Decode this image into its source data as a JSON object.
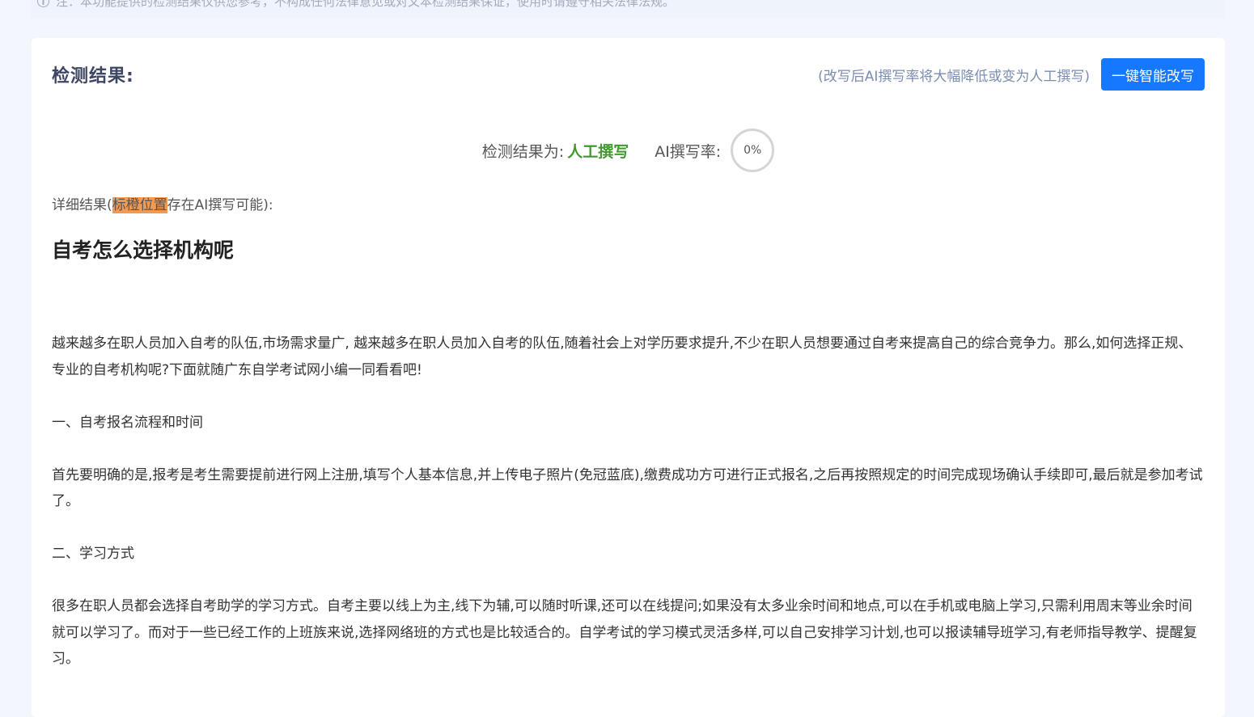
{
  "notice": {
    "text": "注：本功能提供的检测结果仅供您参考，不构成任何法律意见或对文本检测结果保证，使用时请遵守相关法律法规。"
  },
  "result_header": {
    "title": "检测结果:",
    "rewrite_hint": "(改写后AI撰写率将大幅降低或变为人工撰写)",
    "rewrite_button": "一键智能改写"
  },
  "summary": {
    "label": "检测结果为:",
    "verdict": "人工撰写",
    "rate_label": "AI撰写率:",
    "rate_value": "0%",
    "colors": {
      "verdict": "#3f9a2c",
      "button": "#1677ff",
      "highlight": "#f39a52"
    }
  },
  "detail": {
    "prefix": "详细结果(",
    "highlight_text": "标橙位置",
    "suffix": "存在AI撰写可能):"
  },
  "article": {
    "title": "自考怎么选择机构呢",
    "paragraphs": [
      "越来越多在职人员加入自考的队伍,市场需求量广, 越来越多在职人员加入自考的队伍,随着社会上对学历要求提升,不少在职人员想要通过自考来提高自己的综合竞争力。那么,如何选择正规、专业的自考机构呢?下面就随广东自学考试网小编一同看看吧!",
      "一、自考报名流程和时间",
      "首先要明确的是,报考是考生需要提前进行网上注册,填写个人基本信息,并上传电子照片(免冠蓝底),缴费成功方可进行正式报名,之后再按照规定的时间完成现场确认手续即可,最后就是参加考试了。",
      "二、学习方式",
      "很多在职人员都会选择自考助学的学习方式。自考主要以线上为主,线下为辅,可以随时听课,还可以在线提问;如果没有太多业余时间和地点,可以在手机或电脑上学习,只需利用周末等业余时间就可以学习了。而对于一些已经工作的上班族来说,选择网络班的方式也是比较适合的。自学考试的学习模式灵活多样,可以自己安排学习计划,也可以报读辅导班学习,有老师指导教学、提醒复习。"
    ]
  }
}
